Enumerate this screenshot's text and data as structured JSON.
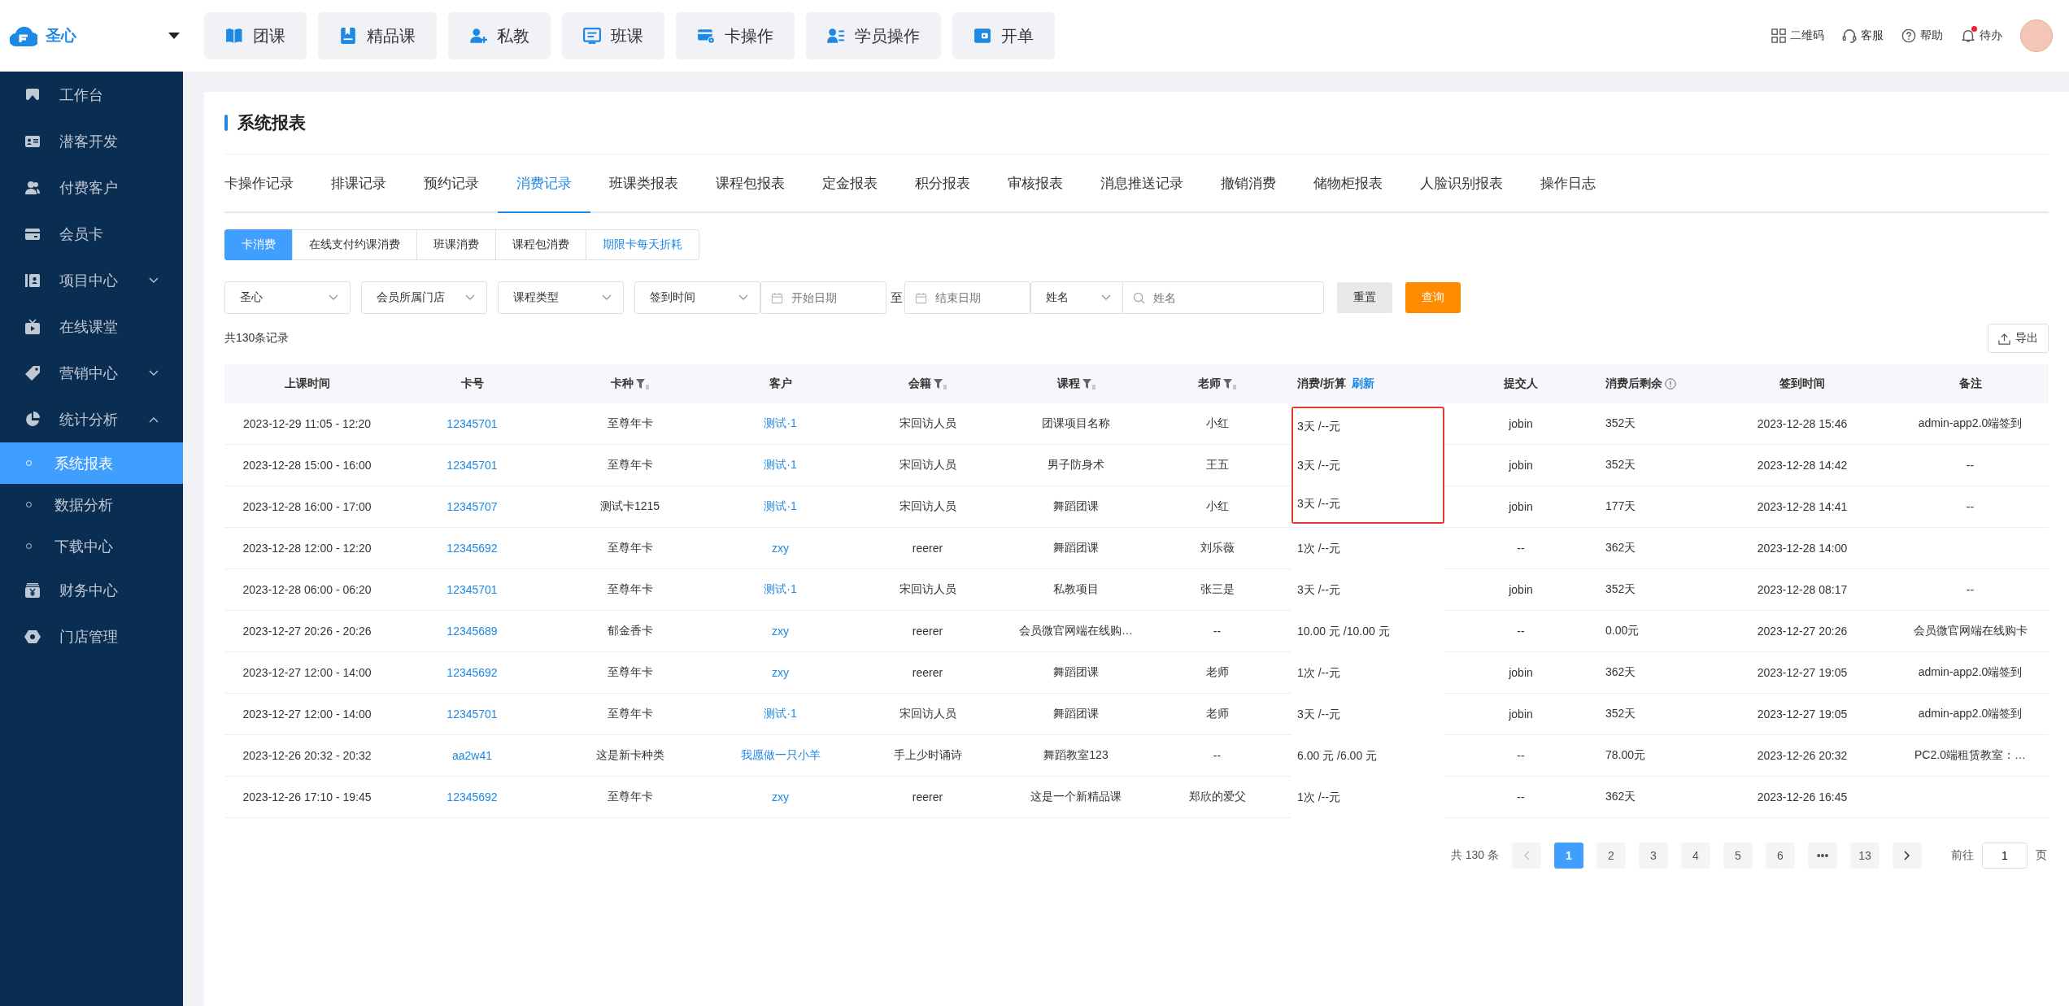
{
  "brand": {
    "name": "圣心"
  },
  "top_nav": [
    {
      "label": "团课"
    },
    {
      "label": "精品课"
    },
    {
      "label": "私教"
    },
    {
      "label": "班课"
    },
    {
      "label": "卡操作"
    },
    {
      "label": "学员操作"
    },
    {
      "label": "开单"
    }
  ],
  "top_actions": [
    {
      "label": "二维码",
      "badge": false
    },
    {
      "label": "客服",
      "badge": false
    },
    {
      "label": "帮助",
      "badge": false
    },
    {
      "label": "待办",
      "badge": true
    }
  ],
  "sidebar": {
    "items": [
      {
        "label": "工作台",
        "kind": "link"
      },
      {
        "label": "潜客开发",
        "kind": "link"
      },
      {
        "label": "付费客户",
        "kind": "link"
      },
      {
        "label": "会员卡",
        "kind": "link"
      },
      {
        "label": "项目中心",
        "kind": "group",
        "expanded": false
      },
      {
        "label": "在线课堂",
        "kind": "link"
      },
      {
        "label": "营销中心",
        "kind": "group",
        "expanded": false
      },
      {
        "label": "统计分析",
        "kind": "group",
        "expanded": true,
        "children": [
          {
            "label": "系统报表",
            "selected": true
          },
          {
            "label": "数据分析",
            "selected": false
          },
          {
            "label": "下载中心",
            "selected": false
          }
        ]
      },
      {
        "label": "财务中心",
        "kind": "link"
      },
      {
        "label": "门店管理",
        "kind": "link"
      }
    ]
  },
  "page_title": "系统报表",
  "tabs": [
    {
      "label": "卡操作记录",
      "selected": false
    },
    {
      "label": "排课记录",
      "selected": false
    },
    {
      "label": "预约记录",
      "selected": false
    },
    {
      "label": "消费记录",
      "selected": true
    },
    {
      "label": "班课类报表",
      "selected": false
    },
    {
      "label": "课程包报表",
      "selected": false
    },
    {
      "label": "定金报表",
      "selected": false
    },
    {
      "label": "积分报表",
      "selected": false
    },
    {
      "label": "审核报表",
      "selected": false
    },
    {
      "label": "消息推送记录",
      "selected": false
    },
    {
      "label": "撤销消费",
      "selected": false
    },
    {
      "label": "储物柜报表",
      "selected": false
    },
    {
      "label": "人脸识别报表",
      "selected": false
    },
    {
      "label": "操作日志",
      "selected": false
    }
  ],
  "sub_tabs": [
    {
      "label": "卡消费",
      "selected": true,
      "emphasized": false
    },
    {
      "label": "在线支付约课消费",
      "selected": false,
      "emphasized": false
    },
    {
      "label": "班课消费",
      "selected": false,
      "emphasized": false
    },
    {
      "label": "课程包消费",
      "selected": false,
      "emphasized": false
    },
    {
      "label": "期限卡每天折耗",
      "selected": false,
      "emphasized": true
    }
  ],
  "filters": [
    {
      "kind": "select",
      "value": "圣心"
    },
    {
      "kind": "select",
      "value": "会员所属门店"
    },
    {
      "kind": "select",
      "value": "课程类型"
    },
    {
      "kind": "select",
      "value": "签到时间"
    },
    {
      "kind": "date",
      "placeholder": "开始日期"
    },
    {
      "kind": "separator",
      "text": "至"
    },
    {
      "kind": "date",
      "placeholder": "结束日期"
    },
    {
      "kind": "select",
      "value": "姓名"
    },
    {
      "kind": "search",
      "placeholder": "姓名"
    }
  ],
  "filter_buttons": [
    {
      "label": "重置",
      "kind": "secondary"
    },
    {
      "label": "查询",
      "kind": "primary"
    }
  ],
  "record_count": "共130条记录",
  "export_button": "导出",
  "table": {
    "columns": [
      {
        "label": "上课时间",
        "kind": "text",
        "filter": false
      },
      {
        "label": "卡号",
        "kind": "link",
        "filter": false
      },
      {
        "label": "卡种",
        "kind": "text",
        "filter": true
      },
      {
        "label": "客户",
        "kind": "link",
        "filter": false
      },
      {
        "label": "会籍",
        "kind": "text",
        "filter": true
      },
      {
        "label": "课程",
        "kind": "text",
        "filter": true
      },
      {
        "label": "老师",
        "kind": "text",
        "filter": true
      },
      {
        "label": "消费/折算",
        "kind": "text",
        "filter": false,
        "action": "刷新"
      },
      {
        "label": "提交人",
        "kind": "text",
        "filter": false
      },
      {
        "label": "消费后剩余",
        "kind": "text",
        "filter": false,
        "info": true
      },
      {
        "label": "签到时间",
        "kind": "text",
        "filter": false
      },
      {
        "label": "备注",
        "kind": "text",
        "filter": false
      }
    ],
    "rows": [
      {
        "highlighted": true,
        "cells": [
          "2023-12-29 11:05 - 12:20",
          "12345701",
          "至尊年卡",
          "测试·1",
          "宋回访人员",
          "团课项目名称",
          "小红",
          "3天 /--元",
          "jobin",
          "352天",
          "2023-12-28 15:46",
          "admin-app2.0端签到"
        ]
      },
      {
        "highlighted": true,
        "cells": [
          "2023-12-28 15:00 - 16:00",
          "12345701",
          "至尊年卡",
          "测试·1",
          "宋回访人员",
          "男子防身术",
          "王五",
          "3天 /--元",
          "jobin",
          "352天",
          "2023-12-28 14:42",
          "--"
        ]
      },
      {
        "highlighted": true,
        "cells": [
          "2023-12-28 16:00 - 17:00",
          "12345707",
          "测试卡1215",
          "测试·1",
          "宋回访人员",
          "舞蹈团课",
          "小红",
          "3天 /--元",
          "jobin",
          "177天",
          "2023-12-28 14:41",
          "--"
        ]
      },
      {
        "highlighted": false,
        "cells": [
          "2023-12-28 12:00 - 12:20",
          "12345692",
          "至尊年卡",
          "zxy",
          "reerer",
          "舞蹈团课",
          "刘乐薇",
          "1次 /--元",
          "--",
          "362天",
          "2023-12-28 14:00",
          null
        ]
      },
      {
        "highlighted": false,
        "cells": [
          "2023-12-28 06:00 - 06:20",
          "12345701",
          "至尊年卡",
          "测试·1",
          "宋回访人员",
          "私教项目",
          "张三是",
          "3天 /--元",
          "jobin",
          "352天",
          "2023-12-28 08:17",
          "--"
        ]
      },
      {
        "highlighted": false,
        "cells": [
          "2023-12-27 20:26 - 20:26",
          "12345689",
          "郁金香卡",
          "zxy",
          "reerer",
          "会员微官网端在线购…",
          "--",
          "10.00 元 /10.00 元",
          "--",
          "0.00元",
          "2023-12-27 20:26",
          "会员微官网端在线购卡"
        ]
      },
      {
        "highlighted": false,
        "cells": [
          "2023-12-27 12:00 - 14:00",
          "12345692",
          "至尊年卡",
          "zxy",
          "reerer",
          "舞蹈团课",
          "老师",
          "1次 /--元",
          "jobin",
          "362天",
          "2023-12-27 19:05",
          "admin-app2.0端签到"
        ]
      },
      {
        "highlighted": false,
        "cells": [
          "2023-12-27 12:00 - 14:00",
          "12345701",
          "至尊年卡",
          "测试·1",
          "宋回访人员",
          "舞蹈团课",
          "老师",
          "3天 /--元",
          "jobin",
          "352天",
          "2023-12-27 19:05",
          "admin-app2.0端签到"
        ]
      },
      {
        "highlighted": false,
        "cells": [
          "2023-12-26 20:32 - 20:32",
          "aa2w41",
          "这是新卡种类",
          "我愿做一只小羊",
          "手上少时诵诗",
          "舞蹈教室123",
          "--",
          "6.00 元 /6.00 元",
          "--",
          "78.00元",
          "2023-12-26 20:32",
          "PC2.0端租赁教室：…"
        ]
      },
      {
        "highlighted": false,
        "cells": [
          "2023-12-26 17:10 - 19:45",
          "12345692",
          "至尊年卡",
          "zxy",
          "reerer",
          "这是一个新精品课",
          "郑欣的爱父",
          "1次 /--元",
          "--",
          "362天",
          "2023-12-26 16:45",
          null
        ]
      }
    ]
  },
  "pagination": {
    "total": "共 130 条",
    "prev_disabled": true,
    "pages": [
      {
        "label": "1",
        "selected": true
      },
      {
        "label": "2",
        "selected": false
      },
      {
        "label": "3",
        "selected": false
      },
      {
        "label": "4",
        "selected": false
      },
      {
        "label": "5",
        "selected": false
      },
      {
        "label": "6",
        "selected": false
      },
      {
        "label": "•••",
        "selected": false
      },
      {
        "label": "13",
        "selected": false
      }
    ],
    "goto_label": "前往",
    "goto_value": "1",
    "page_unit": "页"
  }
}
